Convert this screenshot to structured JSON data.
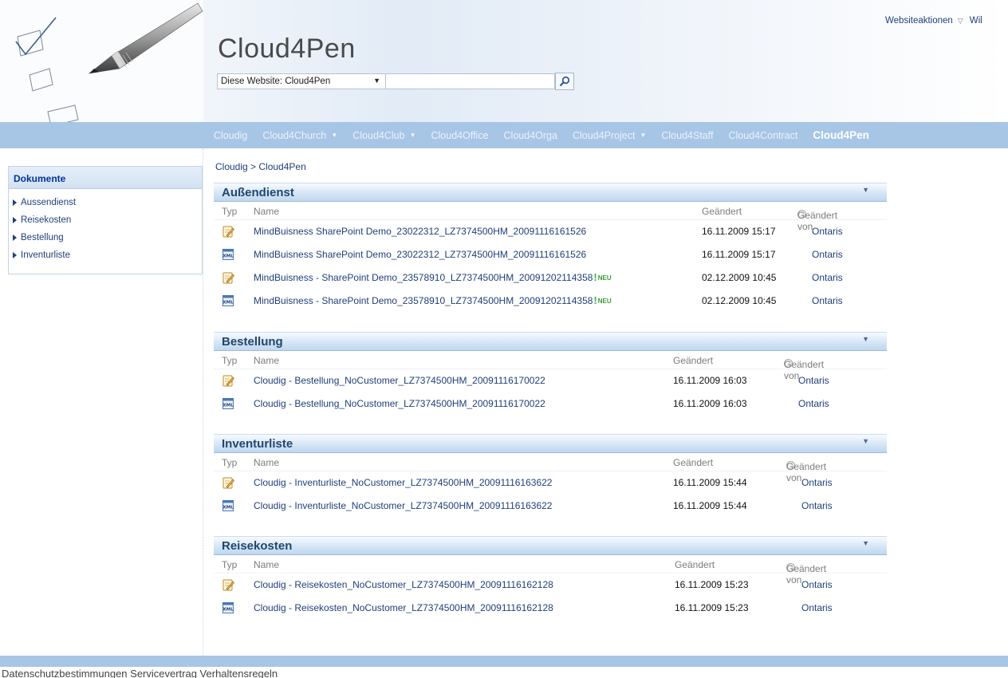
{
  "header": {
    "site_title": "Cloud4Pen",
    "search_scope": "Diese Website: Cloud4Pen",
    "search_placeholder": "",
    "site_actions": "Websiteaktionen",
    "welcome": "Wil"
  },
  "topnav": {
    "items": [
      {
        "label": "Cloudig",
        "has_menu": false
      },
      {
        "label": "Cloud4Church",
        "has_menu": true
      },
      {
        "label": "Cloud4Club",
        "has_menu": true
      },
      {
        "label": "Cloud4Office",
        "has_menu": false
      },
      {
        "label": "Cloud4Orga",
        "has_menu": false
      },
      {
        "label": "Cloud4Project",
        "has_menu": true
      },
      {
        "label": "Cloud4Staff",
        "has_menu": false
      },
      {
        "label": "Cloud4Contract",
        "has_menu": false
      },
      {
        "label": "Cloud4Pen",
        "has_menu": false,
        "active": true
      }
    ]
  },
  "leftnav": {
    "heading": "Dokumente",
    "items": [
      "Aussendienst",
      "Reisekosten",
      "Bestellung",
      "Inventurliste"
    ]
  },
  "breadcrumb": "Cloudig > Cloud4Pen",
  "columns": {
    "type": "Typ",
    "name": "Name",
    "modified": "Geändert",
    "modified_by": "Geändert von"
  },
  "webparts": [
    {
      "title": "Außendienst",
      "rows": [
        {
          "icon": "form-icon",
          "name": "MindBuisness SharePoint Demo_23022312_LZ7374500HM_20091116161526",
          "new": false,
          "modified": "16.11.2009 15:17",
          "author": "Ontaris"
        },
        {
          "icon": "xml-file-icon",
          "name": "MindBuisness SharePoint Demo_23022312_LZ7374500HM_20091116161526",
          "new": false,
          "modified": "16.11.2009 15:17",
          "author": "Ontaris"
        },
        {
          "icon": "form-icon",
          "name": "MindBuisness - SharePoint Demo_23578910_LZ7374500HM_20091202114358",
          "new": true,
          "modified": "02.12.2009 10:45",
          "author": "Ontaris"
        },
        {
          "icon": "xml-file-icon",
          "name": "MindBuisness - SharePoint Demo_23578910_LZ7374500HM_20091202114358",
          "new": true,
          "modified": "02.12.2009 10:45",
          "author": "Ontaris"
        }
      ]
    },
    {
      "title": "Bestellung",
      "rows": [
        {
          "icon": "form-icon",
          "name": "Cloudig - Bestellung_NoCustomer_LZ7374500HM_20091116170022",
          "new": false,
          "modified": "16.11.2009 16:03",
          "author": "Ontaris"
        },
        {
          "icon": "xml-file-icon",
          "name": "Cloudig - Bestellung_NoCustomer_LZ7374500HM_20091116170022",
          "new": false,
          "modified": "16.11.2009 16:03",
          "author": "Ontaris"
        }
      ]
    },
    {
      "title": "Inventurliste",
      "rows": [
        {
          "icon": "form-icon",
          "name": "Cloudig - Inventurliste_NoCustomer_LZ7374500HM_20091116163622",
          "new": false,
          "modified": "16.11.2009 15:44",
          "author": "Ontaris"
        },
        {
          "icon": "xml-file-icon",
          "name": "Cloudig - Inventurliste_NoCustomer_LZ7374500HM_20091116163622",
          "new": false,
          "modified": "16.11.2009 15:44",
          "author": "Ontaris"
        }
      ]
    },
    {
      "title": "Reisekosten",
      "rows": [
        {
          "icon": "form-icon",
          "name": "Cloudig - Reisekosten_NoCustomer_LZ7374500HM_20091116162128",
          "new": false,
          "modified": "16.11.2009 15:23",
          "author": "Ontaris"
        },
        {
          "icon": "xml-file-icon",
          "name": "Cloudig - Reisekosten_NoCustomer_LZ7374500HM_20091116162128",
          "new": false,
          "modified": "16.11.2009 15:23",
          "author": "Ontaris"
        }
      ]
    }
  ],
  "new_label": "NEU",
  "footer": "Datenschutzbestimmungen Servicevertrag Verhaltensregeln",
  "colors": {
    "nav_bar": "#a7c6e6",
    "link": "#1f3f7a",
    "webpart_title": "#22476f",
    "new_badge": "#3cb43c"
  }
}
